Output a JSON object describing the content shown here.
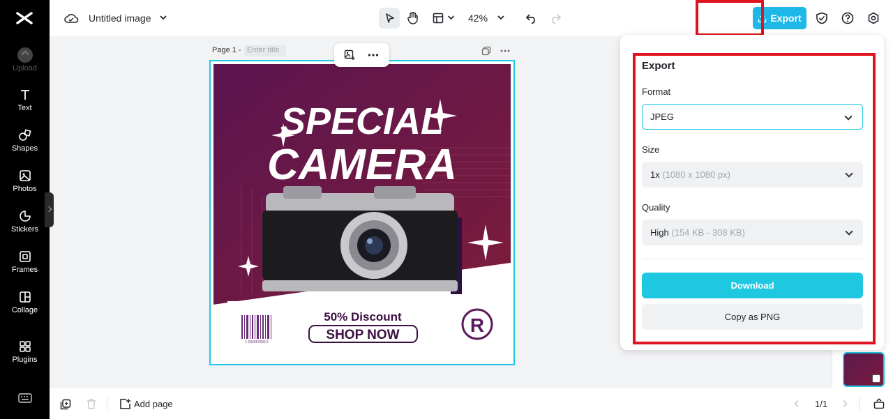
{
  "header": {
    "doc_title": "Untitled image",
    "zoom": "42%",
    "export_label": "Export"
  },
  "sidebar": {
    "items": [
      {
        "label": "Upload",
        "icon": "upload-icon"
      },
      {
        "label": "Text",
        "icon": "text-icon"
      },
      {
        "label": "Shapes",
        "icon": "shapes-icon"
      },
      {
        "label": "Photos",
        "icon": "photos-icon"
      },
      {
        "label": "Stickers",
        "icon": "stickers-icon"
      },
      {
        "label": "Frames",
        "icon": "frames-icon"
      },
      {
        "label": "Collage",
        "icon": "collage-icon"
      },
      {
        "label": "Plugins",
        "icon": "plugins-icon"
      }
    ]
  },
  "canvas": {
    "page_label": "Page 1 -",
    "title_placeholder": "Enter title"
  },
  "design": {
    "headline_1": "SPECIAL",
    "headline_2": "CAMERA",
    "discount": "50% Discount",
    "cta": "SHOP NOW",
    "registered": "R",
    "barcode_digits": "1 234567890 2"
  },
  "export_panel": {
    "title": "Export",
    "format_label": "Format",
    "format_value": "JPEG",
    "size_label": "Size",
    "size_value": "1x",
    "size_detail": "(1080 x 1080 px)",
    "quality_label": "Quality",
    "quality_value": "High",
    "quality_detail": "(154 KB - 308 KB)",
    "download_label": "Download",
    "copy_label": "Copy as PNG"
  },
  "footer": {
    "add_page_label": "Add page",
    "pagination": "1/1"
  },
  "colors": {
    "accent": "#1db8e8",
    "highlight": "#e0141e",
    "sidebar_bg": "#000000"
  }
}
